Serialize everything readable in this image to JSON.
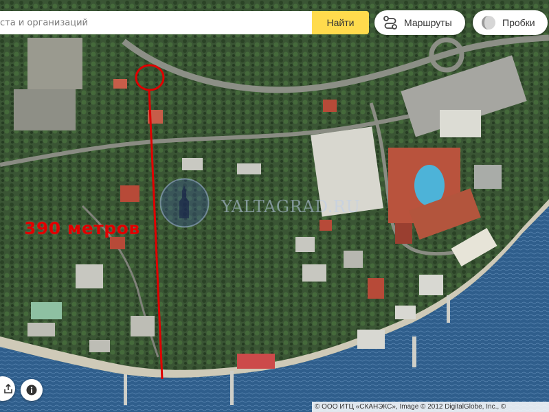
{
  "search": {
    "placeholder": "Поиск мест и адресов, объектов и организаций",
    "visible_placeholder": "ста и организаций",
    "button_label": "Найти"
  },
  "controls": {
    "routes_label": "Маршруты",
    "traffic_label": "Пробки",
    "share_icon": "share-icon",
    "info_icon": "info-icon"
  },
  "annotation": {
    "distance_label": "390 метров",
    "line_color": "#e00000"
  },
  "watermark": {
    "text": "YALTAGRAD.RU"
  },
  "copyright": {
    "text": "© ООО ИТЦ «СКАНЭКС», Image © 2012 DigitalGlobe, Inc., ©"
  },
  "colors": {
    "search_button": "#ffdb4d",
    "annotation": "#e00000",
    "sea": "#2f5d88",
    "vegetation": "#35512f"
  }
}
